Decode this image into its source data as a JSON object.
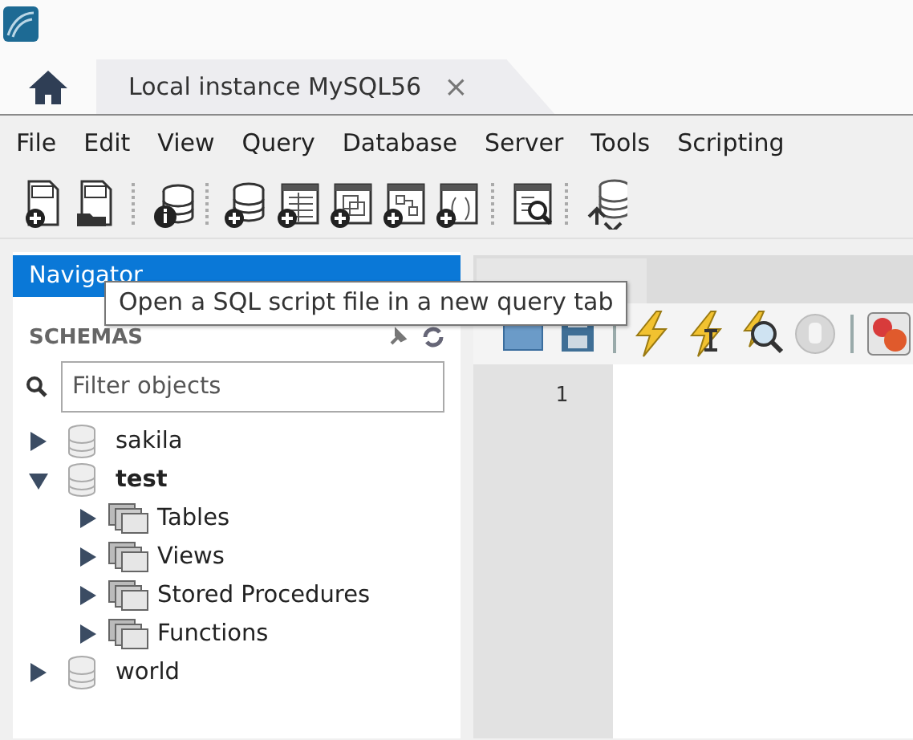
{
  "tabs": [
    {
      "kind": "home",
      "selected": false
    },
    {
      "kind": "connection",
      "label": "Local instance MySQL56",
      "close": "×",
      "selected": true
    }
  ],
  "menu": [
    "File",
    "Edit",
    "View",
    "Query",
    "Database",
    "Server",
    "Tools",
    "Scripting"
  ],
  "navigator": {
    "title": "Navigator",
    "section": "SCHEMAS",
    "filter": {
      "placeholder": "Filter objects"
    },
    "schemas": [
      {
        "label": "sakila",
        "expanded": false,
        "default": false
      },
      {
        "label": "test",
        "expanded": true,
        "default": true,
        "children": [
          {
            "label": "Tables",
            "expanded": false
          },
          {
            "label": "Views",
            "expanded": false
          },
          {
            "label": "Stored Procedures",
            "expanded": false
          },
          {
            "label": "Functions",
            "expanded": false
          }
        ]
      },
      {
        "label": "world",
        "expanded": false,
        "default": false
      }
    ]
  },
  "editor": {
    "line_numbers": [
      "1"
    ]
  },
  "tooltip": "Open a SQL script file in a new query tab"
}
